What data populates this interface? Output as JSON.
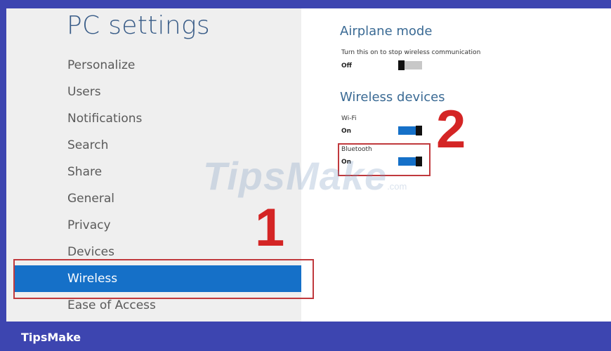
{
  "title": "PC settings",
  "nav": {
    "items": [
      {
        "label": "Personalize"
      },
      {
        "label": "Users"
      },
      {
        "label": "Notifications"
      },
      {
        "label": "Search"
      },
      {
        "label": "Share"
      },
      {
        "label": "General"
      },
      {
        "label": "Privacy"
      },
      {
        "label": "Devices"
      },
      {
        "label": "Wireless",
        "selected": true
      },
      {
        "label": "Ease of Access"
      }
    ]
  },
  "airplane": {
    "title": "Airplane mode",
    "description": "Turn this on to stop wireless communication",
    "state": "Off"
  },
  "wireless_devices": {
    "title": "Wireless devices",
    "wifi": {
      "label": "Wi-Fi",
      "state": "On"
    },
    "bluetooth": {
      "label": "Bluetooth",
      "state": "On"
    }
  },
  "annotations": {
    "one": "1",
    "two": "2"
  },
  "watermark": {
    "text": "TipsMake",
    "suffix": ".com"
  },
  "footer": {
    "brand": "TipsMake"
  },
  "colors": {
    "accent": "#1570c8",
    "frame": "#3d45b0",
    "annotation": "#d42525",
    "title": "#3a5d88"
  }
}
